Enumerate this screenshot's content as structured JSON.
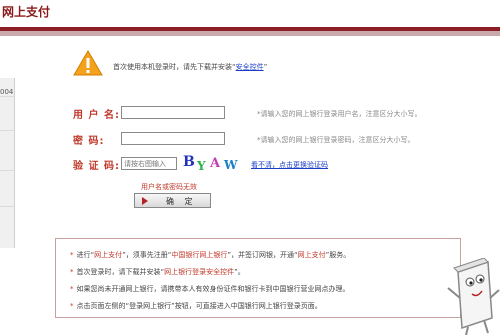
{
  "header": {
    "title": "网上支付"
  },
  "left_panel": {
    "text": "004"
  },
  "notice": {
    "prefix": "首次使用本机登录时，请先下载并安装“",
    "link": "安全控件",
    "suffix": "”"
  },
  "form": {
    "username": {
      "label": "用 户 名:",
      "value": "",
      "hint": "*请输入您的网上银行登录用户名，注意区分大小写。"
    },
    "password": {
      "label": "密    码:",
      "value": "",
      "hint": "*请输入您的网上银行登录密码，注意区分大小写。"
    },
    "captcha": {
      "label": "验 证 码:",
      "placeholder": "请按右图输入",
      "image_text": "BYAW",
      "refresh_link": "看不清，点击更换验证码"
    },
    "error_message": "用户名或密码无效",
    "confirm_label": "确  定"
  },
  "info": {
    "lines": [
      {
        "star": "*",
        "parts": [
          {
            "t": "进行“"
          },
          {
            "t": "网上支付",
            "em": true
          },
          {
            "t": "”，须事先注册“"
          },
          {
            "t": "中国银行网上银行",
            "em": true
          },
          {
            "t": "”，并签订网银，开通“"
          },
          {
            "t": "网上支付",
            "em": true
          },
          {
            "t": "”服务。"
          }
        ]
      },
      {
        "star": "*",
        "parts": [
          {
            "t": "首次登录时，请下载并安装“"
          },
          {
            "t": "网上银行登录安全控件",
            "em": true
          },
          {
            "t": "”。"
          }
        ]
      },
      {
        "star": "*",
        "parts": [
          {
            "t": "如果您尚未开通网上银行，请携带本人有效身份证件和银行卡到中国银行营业网点办理。"
          }
        ]
      },
      {
        "star": "*",
        "parts": [
          {
            "t": "点击页面左侧的“登录网上银行”按钮，可直接进入中国银行网上银行登录页面。"
          }
        ]
      }
    ]
  },
  "colors": {
    "brand": "#8c1d24",
    "label": "#c0392b",
    "link": "#1a3cc8"
  }
}
